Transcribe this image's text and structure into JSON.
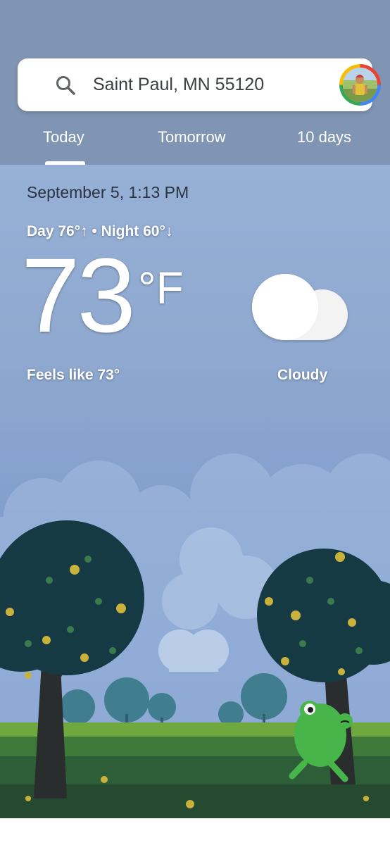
{
  "search": {
    "location": "Saint Paul, MN 55120",
    "icon": "search-icon",
    "avatar": "account-avatar"
  },
  "tabs": [
    {
      "label": "Today",
      "selected": true
    },
    {
      "label": "Tomorrow",
      "selected": false
    },
    {
      "label": "10 days",
      "selected": false
    }
  ],
  "weather": {
    "date_time": "September 5, 1:13 PM",
    "day_night": "Day 76°↑ • Night 60°↓",
    "temperature": "73",
    "unit": "°F",
    "feels_like": "Feels like 73°",
    "condition": "Cloudy",
    "condition_icon": "cloud-icon"
  },
  "colors": {
    "header_bg": "#8095b3",
    "sky_top": "#97b0d6",
    "sky_bottom": "#6f93c4",
    "frog": "#47b549"
  }
}
